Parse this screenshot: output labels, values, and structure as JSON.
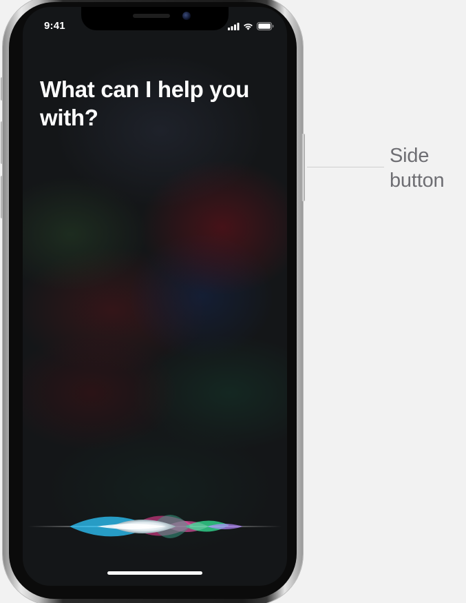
{
  "status_bar": {
    "time": "9:41",
    "icons": [
      "cellular-signal-icon",
      "wifi-icon",
      "battery-icon"
    ]
  },
  "siri": {
    "prompt": "What can I help you with?",
    "waveform_colors": [
      "#39d0ff",
      "#ff3fa3",
      "#3cff9a",
      "#ffffff",
      "#a86bff"
    ]
  },
  "callout": {
    "label": "Side button"
  },
  "colors": {
    "page_background": "#f2f2f2",
    "callout_text": "#6e6e73",
    "prompt_text": "#ffffff"
  }
}
